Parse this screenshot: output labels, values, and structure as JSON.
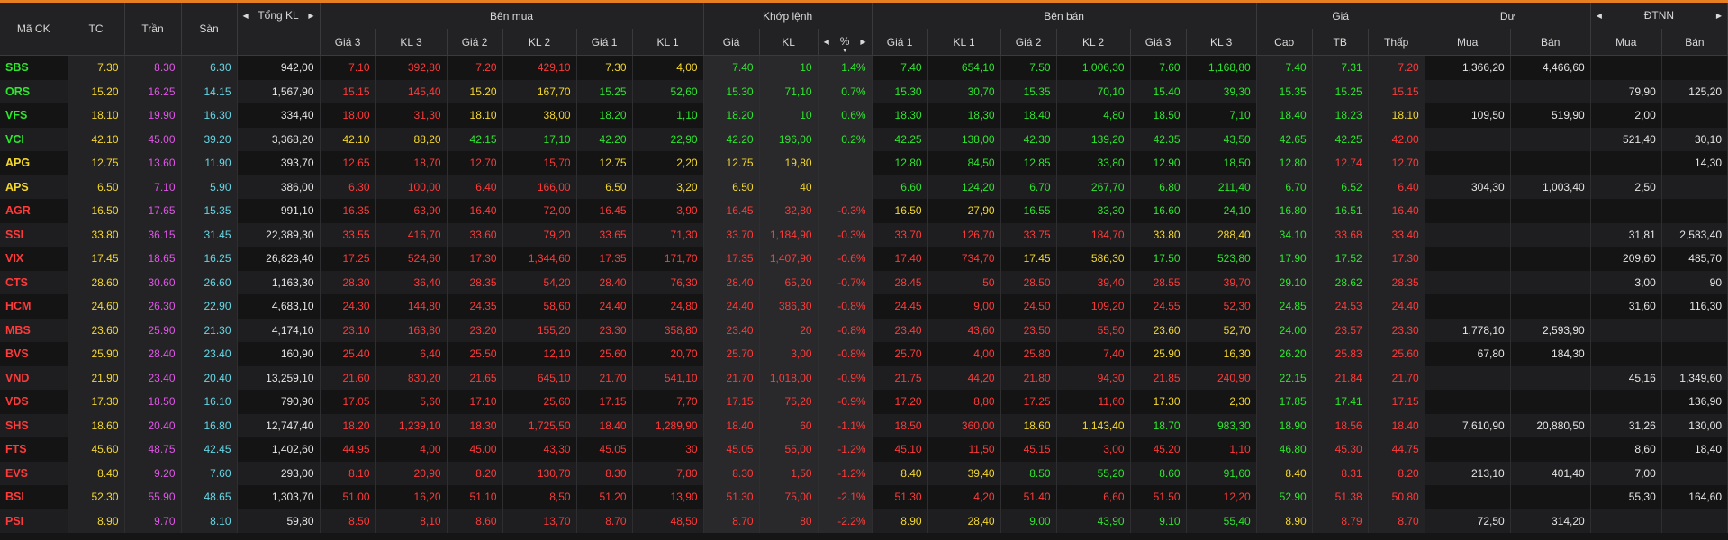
{
  "header": {
    "groups": {
      "symbol": "Mã CK",
      "ref": "TC",
      "ceil": "Trần",
      "floor": "Sàn",
      "total_vol": "Tổng KL",
      "buy_side": "Bên mua",
      "matched": "Khớp lệnh",
      "sell_side": "Bên bán",
      "price": "Giá",
      "remaining": "Dư",
      "foreign": "ĐTNN"
    },
    "sub": {
      "buy": [
        "Giá 3",
        "KL 3",
        "Giá 2",
        "KL 2",
        "Giá 1",
        "KL 1"
      ],
      "match": [
        "Giá",
        "KL",
        "%"
      ],
      "sell": [
        "Giá 1",
        "KL 1",
        "Giá 2",
        "KL 2",
        "Giá 3",
        "KL 3"
      ],
      "price": [
        "Cao",
        "TB",
        "Thấp"
      ],
      "remaining": [
        "Mua",
        "Bán"
      ],
      "foreign": [
        "Mua",
        "Bán"
      ]
    }
  },
  "colors": {
    "up": "#2ee62e",
    "down": "#ff3a3a",
    "ref": "#f5d82e",
    "ceiling": "#e255ea",
    "floor": "#64d7e6",
    "neutral": "#e6e6e6",
    "accent": "#e67e22"
  },
  "rows": [
    {
      "sym": "SBS",
      "tc": "7.30",
      "tran": "8.30",
      "san": "6.30",
      "tong": "942,00",
      "b": [
        "7.10",
        "392,80",
        "7.20",
        "429,10",
        "7.30",
        "4,00"
      ],
      "m": [
        "7.40",
        "10",
        "1.4%"
      ],
      "s": [
        "7.40",
        "654,10",
        "7.50",
        "1,006,30",
        "7.60",
        "1,168,80"
      ],
      "p": [
        "7.40",
        "7.31",
        "7.20"
      ],
      "du": [
        "1,366,20",
        "4,466,60"
      ],
      "nn": [
        "",
        ""
      ]
    },
    {
      "sym": "ORS",
      "tc": "15.20",
      "tran": "16.25",
      "san": "14.15",
      "tong": "1,567,90",
      "b": [
        "15.15",
        "145,40",
        "15.20",
        "167,70",
        "15.25",
        "52,60"
      ],
      "m": [
        "15.30",
        "71,10",
        "0.7%"
      ],
      "s": [
        "15.30",
        "30,70",
        "15.35",
        "70,10",
        "15.40",
        "39,30"
      ],
      "p": [
        "15.35",
        "15.25",
        "15.15"
      ],
      "du": [
        "",
        ""
      ],
      "nn": [
        "79,90",
        "125,20"
      ]
    },
    {
      "sym": "VFS",
      "tc": "18.10",
      "tran": "19.90",
      "san": "16.30",
      "tong": "334,40",
      "b": [
        "18.00",
        "31,30",
        "18.10",
        "38,00",
        "18.20",
        "1,10"
      ],
      "m": [
        "18.20",
        "10",
        "0.6%"
      ],
      "s": [
        "18.30",
        "18,30",
        "18.40",
        "4,80",
        "18.50",
        "7,10"
      ],
      "p": [
        "18.40",
        "18.23",
        "18.10"
      ],
      "du": [
        "109,50",
        "519,90"
      ],
      "nn": [
        "2,00",
        ""
      ]
    },
    {
      "sym": "VCI",
      "tc": "42.10",
      "tran": "45.00",
      "san": "39.20",
      "tong": "3,368,20",
      "b": [
        "42.10",
        "88,20",
        "42.15",
        "17,10",
        "42.20",
        "22,90"
      ],
      "m": [
        "42.20",
        "196,00",
        "0.2%"
      ],
      "s": [
        "42.25",
        "138,00",
        "42.30",
        "139,20",
        "42.35",
        "43,50"
      ],
      "p": [
        "42.65",
        "42.25",
        "42.00"
      ],
      "du": [
        "",
        ""
      ],
      "nn": [
        "521,40",
        "30,10"
      ]
    },
    {
      "sym": "APG",
      "tc": "12.75",
      "tran": "13.60",
      "san": "11.90",
      "tong": "393,70",
      "b": [
        "12.65",
        "18,70",
        "12.70",
        "15,70",
        "12.75",
        "2,20"
      ],
      "m": [
        "12.75",
        "19,80",
        ""
      ],
      "s": [
        "12.80",
        "84,50",
        "12.85",
        "33,80",
        "12.90",
        "18,50"
      ],
      "p": [
        "12.80",
        "12.74",
        "12.70"
      ],
      "du": [
        "",
        ""
      ],
      "nn": [
        "",
        "14,30"
      ]
    },
    {
      "sym": "APS",
      "tc": "6.50",
      "tran": "7.10",
      "san": "5.90",
      "tong": "386,00",
      "b": [
        "6.30",
        "100,00",
        "6.40",
        "166,00",
        "6.50",
        "3,20"
      ],
      "m": [
        "6.50",
        "40",
        ""
      ],
      "s": [
        "6.60",
        "124,20",
        "6.70",
        "267,70",
        "6.80",
        "211,40"
      ],
      "p": [
        "6.70",
        "6.52",
        "6.40"
      ],
      "du": [
        "304,30",
        "1,003,40"
      ],
      "nn": [
        "2,50",
        ""
      ]
    },
    {
      "sym": "AGR",
      "tc": "16.50",
      "tran": "17.65",
      "san": "15.35",
      "tong": "991,10",
      "b": [
        "16.35",
        "63,90",
        "16.40",
        "72,00",
        "16.45",
        "3,90"
      ],
      "m": [
        "16.45",
        "32,80",
        "-0.3%"
      ],
      "s": [
        "16.50",
        "27,90",
        "16.55",
        "33,30",
        "16.60",
        "24,10"
      ],
      "p": [
        "16.80",
        "16.51",
        "16.40"
      ],
      "du": [
        "",
        ""
      ],
      "nn": [
        "",
        ""
      ]
    },
    {
      "sym": "SSI",
      "tc": "33.80",
      "tran": "36.15",
      "san": "31.45",
      "tong": "22,389,30",
      "b": [
        "33.55",
        "416,70",
        "33.60",
        "79,20",
        "33.65",
        "71,30"
      ],
      "m": [
        "33.70",
        "1,184,90",
        "-0.3%"
      ],
      "s": [
        "33.70",
        "126,70",
        "33.75",
        "184,70",
        "33.80",
        "288,40"
      ],
      "p": [
        "34.10",
        "33.68",
        "33.40"
      ],
      "du": [
        "",
        ""
      ],
      "nn": [
        "31,81",
        "2,583,40"
      ]
    },
    {
      "sym": "VIX",
      "tc": "17.45",
      "tran": "18.65",
      "san": "16.25",
      "tong": "26,828,40",
      "b": [
        "17.25",
        "524,60",
        "17.30",
        "1,344,60",
        "17.35",
        "171,70"
      ],
      "m": [
        "17.35",
        "1,407,90",
        "-0.6%"
      ],
      "s": [
        "17.40",
        "734,70",
        "17.45",
        "586,30",
        "17.50",
        "523,80"
      ],
      "p": [
        "17.90",
        "17.52",
        "17.30"
      ],
      "du": [
        "",
        ""
      ],
      "nn": [
        "209,60",
        "485,70"
      ]
    },
    {
      "sym": "CTS",
      "tc": "28.60",
      "tran": "30.60",
      "san": "26.60",
      "tong": "1,163,30",
      "b": [
        "28.30",
        "36,40",
        "28.35",
        "54,20",
        "28.40",
        "76,30"
      ],
      "m": [
        "28.40",
        "65,20",
        "-0.7%"
      ],
      "s": [
        "28.45",
        "50",
        "28.50",
        "39,40",
        "28.55",
        "39,70"
      ],
      "p": [
        "29.10",
        "28.62",
        "28.35"
      ],
      "du": [
        "",
        ""
      ],
      "nn": [
        "3,00",
        "90"
      ]
    },
    {
      "sym": "HCM",
      "tc": "24.60",
      "tran": "26.30",
      "san": "22.90",
      "tong": "4,683,10",
      "b": [
        "24.30",
        "144,80",
        "24.35",
        "58,60",
        "24.40",
        "24,80"
      ],
      "m": [
        "24.40",
        "386,30",
        "-0.8%"
      ],
      "s": [
        "24.45",
        "9,00",
        "24.50",
        "109,20",
        "24.55",
        "52,30"
      ],
      "p": [
        "24.85",
        "24.53",
        "24.40"
      ],
      "du": [
        "",
        ""
      ],
      "nn": [
        "31,60",
        "116,30"
      ]
    },
    {
      "sym": "MBS",
      "tc": "23.60",
      "tran": "25.90",
      "san": "21.30",
      "tong": "4,174,10",
      "b": [
        "23.10",
        "163,80",
        "23.20",
        "155,20",
        "23.30",
        "358,80"
      ],
      "m": [
        "23.40",
        "20",
        "-0.8%"
      ],
      "s": [
        "23.40",
        "43,60",
        "23.50",
        "55,50",
        "23.60",
        "52,70"
      ],
      "p": [
        "24.00",
        "23.57",
        "23.30"
      ],
      "du": [
        "1,778,10",
        "2,593,90"
      ],
      "nn": [
        "",
        ""
      ]
    },
    {
      "sym": "BVS",
      "tc": "25.90",
      "tran": "28.40",
      "san": "23.40",
      "tong": "160,90",
      "b": [
        "25.40",
        "6,40",
        "25.50",
        "12,10",
        "25.60",
        "20,70"
      ],
      "m": [
        "25.70",
        "3,00",
        "-0.8%"
      ],
      "s": [
        "25.70",
        "4,00",
        "25.80",
        "7,40",
        "25.90",
        "16,30"
      ],
      "p": [
        "26.20",
        "25.83",
        "25.60"
      ],
      "du": [
        "67,80",
        "184,30"
      ],
      "nn": [
        "",
        ""
      ]
    },
    {
      "sym": "VND",
      "tc": "21.90",
      "tran": "23.40",
      "san": "20.40",
      "tong": "13,259,10",
      "b": [
        "21.60",
        "830,20",
        "21.65",
        "645,10",
        "21.70",
        "541,10"
      ],
      "m": [
        "21.70",
        "1,018,00",
        "-0.9%"
      ],
      "s": [
        "21.75",
        "44,20",
        "21.80",
        "94,30",
        "21.85",
        "240,90"
      ],
      "p": [
        "22.15",
        "21.84",
        "21.70"
      ],
      "du": [
        "",
        ""
      ],
      "nn": [
        "45,16",
        "1,349,60"
      ]
    },
    {
      "sym": "VDS",
      "tc": "17.30",
      "tran": "18.50",
      "san": "16.10",
      "tong": "790,90",
      "b": [
        "17.05",
        "5,60",
        "17.10",
        "25,60",
        "17.15",
        "7,70"
      ],
      "m": [
        "17.15",
        "75,20",
        "-0.9%"
      ],
      "s": [
        "17.20",
        "8,80",
        "17.25",
        "11,60",
        "17.30",
        "2,30"
      ],
      "p": [
        "17.85",
        "17.41",
        "17.15"
      ],
      "du": [
        "",
        ""
      ],
      "nn": [
        "",
        "136,90"
      ]
    },
    {
      "sym": "SHS",
      "tc": "18.60",
      "tran": "20.40",
      "san": "16.80",
      "tong": "12,747,40",
      "b": [
        "18.20",
        "1,239,10",
        "18.30",
        "1,725,50",
        "18.40",
        "1,289,90"
      ],
      "m": [
        "18.40",
        "60",
        "-1.1%"
      ],
      "s": [
        "18.50",
        "360,00",
        "18.60",
        "1,143,40",
        "18.70",
        "983,30"
      ],
      "p": [
        "18.90",
        "18.56",
        "18.40"
      ],
      "du": [
        "7,610,90",
        "20,880,50"
      ],
      "nn": [
        "31,26",
        "130,00"
      ]
    },
    {
      "sym": "FTS",
      "tc": "45.60",
      "tran": "48.75",
      "san": "42.45",
      "tong": "1,402,60",
      "b": [
        "44.95",
        "4,00",
        "45.00",
        "43,30",
        "45.05",
        "30"
      ],
      "m": [
        "45.05",
        "55,00",
        "-1.2%"
      ],
      "s": [
        "45.10",
        "11,50",
        "45.15",
        "3,00",
        "45.20",
        "1,10"
      ],
      "p": [
        "46.80",
        "45.30",
        "44.75"
      ],
      "du": [
        "",
        ""
      ],
      "nn": [
        "8,60",
        "18,40"
      ]
    },
    {
      "sym": "EVS",
      "tc": "8.40",
      "tran": "9.20",
      "san": "7.60",
      "tong": "293,00",
      "b": [
        "8.10",
        "20,90",
        "8.20",
        "130,70",
        "8.30",
        "7,80"
      ],
      "m": [
        "8.30",
        "1,50",
        "-1.2%"
      ],
      "s": [
        "8.40",
        "39,40",
        "8.50",
        "55,20",
        "8.60",
        "91,60"
      ],
      "p": [
        "8.40",
        "8.31",
        "8.20"
      ],
      "du": [
        "213,10",
        "401,40"
      ],
      "nn": [
        "7,00",
        ""
      ]
    },
    {
      "sym": "BSI",
      "tc": "52.30",
      "tran": "55.90",
      "san": "48.65",
      "tong": "1,303,70",
      "b": [
        "51.00",
        "16,20",
        "51.10",
        "8,50",
        "51.20",
        "13,90"
      ],
      "m": [
        "51.30",
        "75,00",
        "-2.1%"
      ],
      "s": [
        "51.30",
        "4,20",
        "51.40",
        "6,60",
        "51.50",
        "12,20"
      ],
      "p": [
        "52.90",
        "51.38",
        "50.80"
      ],
      "du": [
        "",
        ""
      ],
      "nn": [
        "55,30",
        "164,60"
      ]
    },
    {
      "sym": "PSI",
      "tc": "8.90",
      "tran": "9.70",
      "san": "8.10",
      "tong": "59,80",
      "b": [
        "8.50",
        "8,10",
        "8.60",
        "13,70",
        "8.70",
        "48,50"
      ],
      "m": [
        "8.70",
        "80",
        "-2.2%"
      ],
      "s": [
        "8.90",
        "28,40",
        "9.00",
        "43,90",
        "9.10",
        "55,40"
      ],
      "p": [
        "8.90",
        "8.79",
        "8.70"
      ],
      "du": [
        "72,50",
        "314,20"
      ],
      "nn": [
        "",
        ""
      ]
    }
  ]
}
